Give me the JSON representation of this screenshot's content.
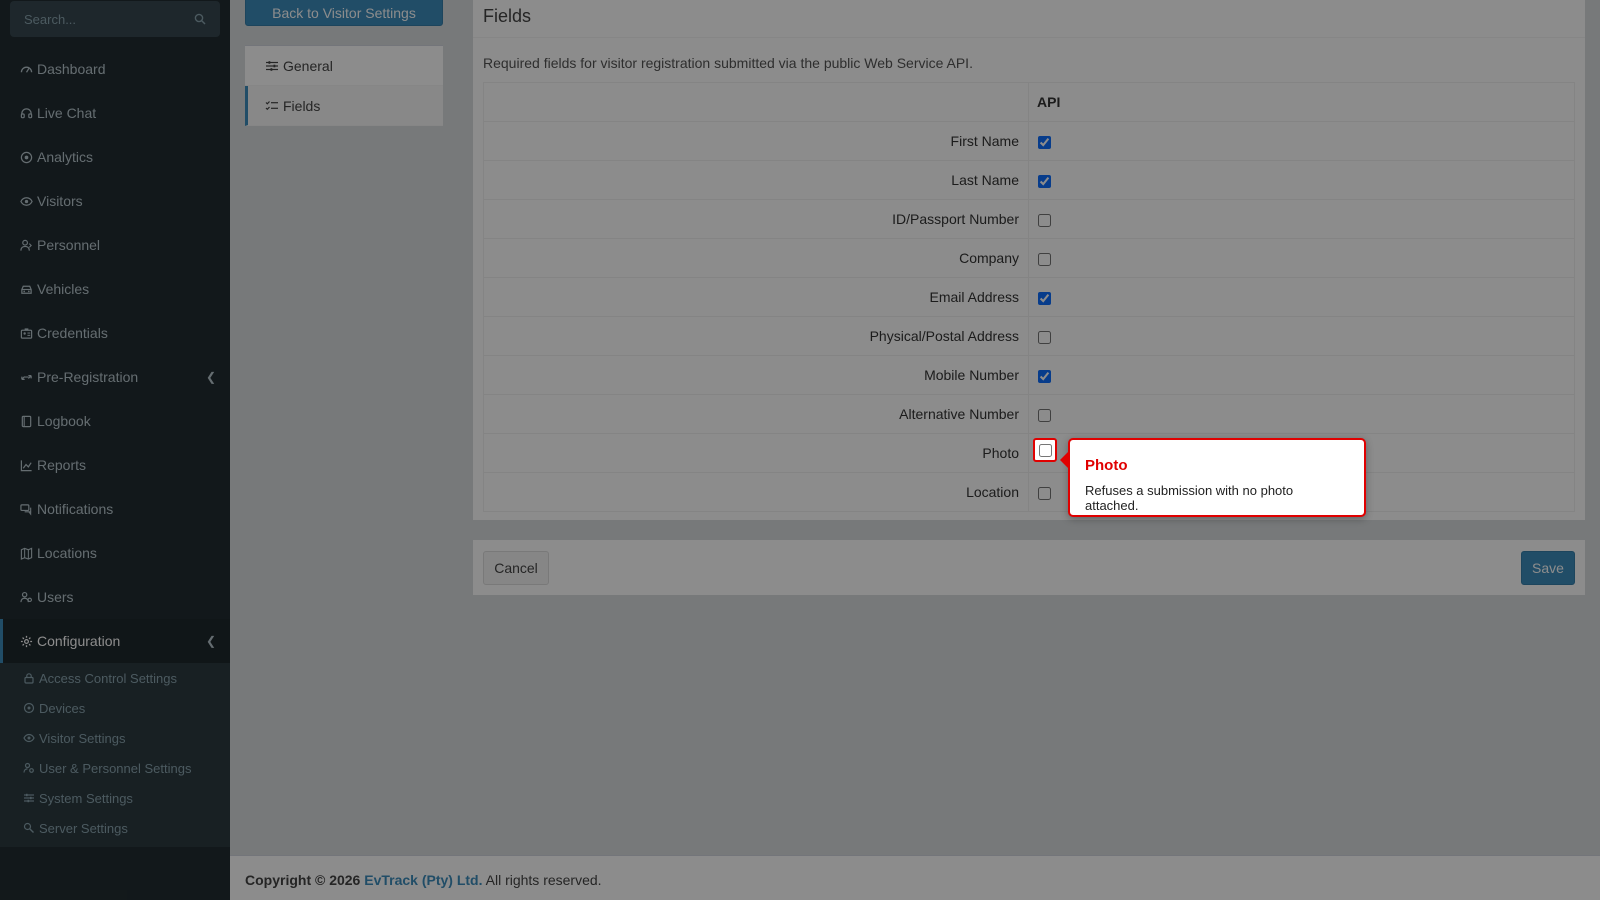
{
  "sidebar": {
    "search_placeholder": "Search...",
    "items": [
      {
        "label": "Dashboard",
        "icon": "dashboard-icon"
      },
      {
        "label": "Live Chat",
        "icon": "headset-icon"
      },
      {
        "label": "Analytics",
        "icon": "target-icon"
      },
      {
        "label": "Visitors",
        "icon": "eye-icon"
      },
      {
        "label": "Personnel",
        "icon": "user-tie-icon"
      },
      {
        "label": "Vehicles",
        "icon": "car-icon"
      },
      {
        "label": "Credentials",
        "icon": "id-card-icon"
      },
      {
        "label": "Pre-Registration",
        "icon": "arrows-icon"
      },
      {
        "label": "Logbook",
        "icon": "book-icon"
      },
      {
        "label": "Reports",
        "icon": "chart-icon"
      },
      {
        "label": "Notifications",
        "icon": "comments-icon"
      },
      {
        "label": "Locations",
        "icon": "map-icon"
      },
      {
        "label": "Users",
        "icon": "users-icon"
      },
      {
        "label": "Configuration",
        "icon": "gear-icon"
      }
    ],
    "config_sub": [
      {
        "label": "Access Control Settings",
        "icon": "lock-icon"
      },
      {
        "label": "Devices",
        "icon": "device-icon"
      },
      {
        "label": "Visitor Settings",
        "icon": "eye-icon"
      },
      {
        "label": "User & Personnel Settings",
        "icon": "user-gear-icon"
      },
      {
        "label": "System Settings",
        "icon": "sliders-icon"
      },
      {
        "label": "Server Settings",
        "icon": "server-icon"
      }
    ]
  },
  "content": {
    "back_button": "Back to Visitor Settings",
    "tabs": [
      {
        "label": "General",
        "icon": "sliders-icon"
      },
      {
        "label": "Fields",
        "icon": "list-check-icon"
      }
    ],
    "panel": {
      "title": "Fields",
      "description": "Required fields for visitor registration submitted via the public Web Service API.",
      "column_header": "API",
      "rows": [
        {
          "label": "First Name",
          "checked": true
        },
        {
          "label": "Last Name",
          "checked": true
        },
        {
          "label": "ID/Passport Number",
          "checked": false
        },
        {
          "label": "Company",
          "checked": false
        },
        {
          "label": "Email Address",
          "checked": true
        },
        {
          "label": "Physical/Postal Address",
          "checked": false
        },
        {
          "label": "Mobile Number",
          "checked": true
        },
        {
          "label": "Alternative Number",
          "checked": false
        },
        {
          "label": "Photo",
          "checked": false
        },
        {
          "label": "Location",
          "checked": false
        }
      ]
    },
    "cancel_button": "Cancel",
    "save_button": "Save"
  },
  "tooltip": {
    "title": "Photo",
    "text": "Refuses a submission with no photo attached."
  },
  "footer": {
    "copyright": "Copyright © 2026",
    "company": "EvTrack (Pty) Ltd.",
    "rights": "All rights reserved."
  },
  "colors": {
    "sidebar_bg": "#222d32",
    "accent": "#3c8dbc",
    "highlight": "#e00000"
  }
}
